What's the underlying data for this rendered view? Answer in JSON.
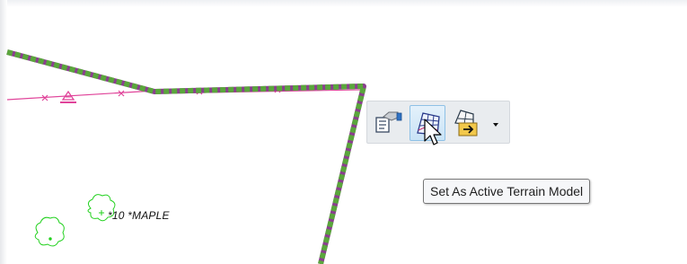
{
  "drawing": {
    "plant_label": "*10 *MAPLE",
    "colors": {
      "fence_line": "#e0449a",
      "boundary_dash": "#5aa63c",
      "boundary_base": "#8a3f8e",
      "shrub": "#22d11e"
    }
  },
  "toolbar": {
    "items": [
      {
        "name": "properties-tool",
        "icon": "terrain-properties-icon",
        "active": false
      },
      {
        "name": "set-active-terrain-tool",
        "icon": "terrain-mesh-icon",
        "active": true
      },
      {
        "name": "terrain-export-tool",
        "icon": "terrain-export-icon",
        "active": false
      }
    ]
  },
  "tooltip": {
    "text": "Set As Active Terrain Model"
  }
}
